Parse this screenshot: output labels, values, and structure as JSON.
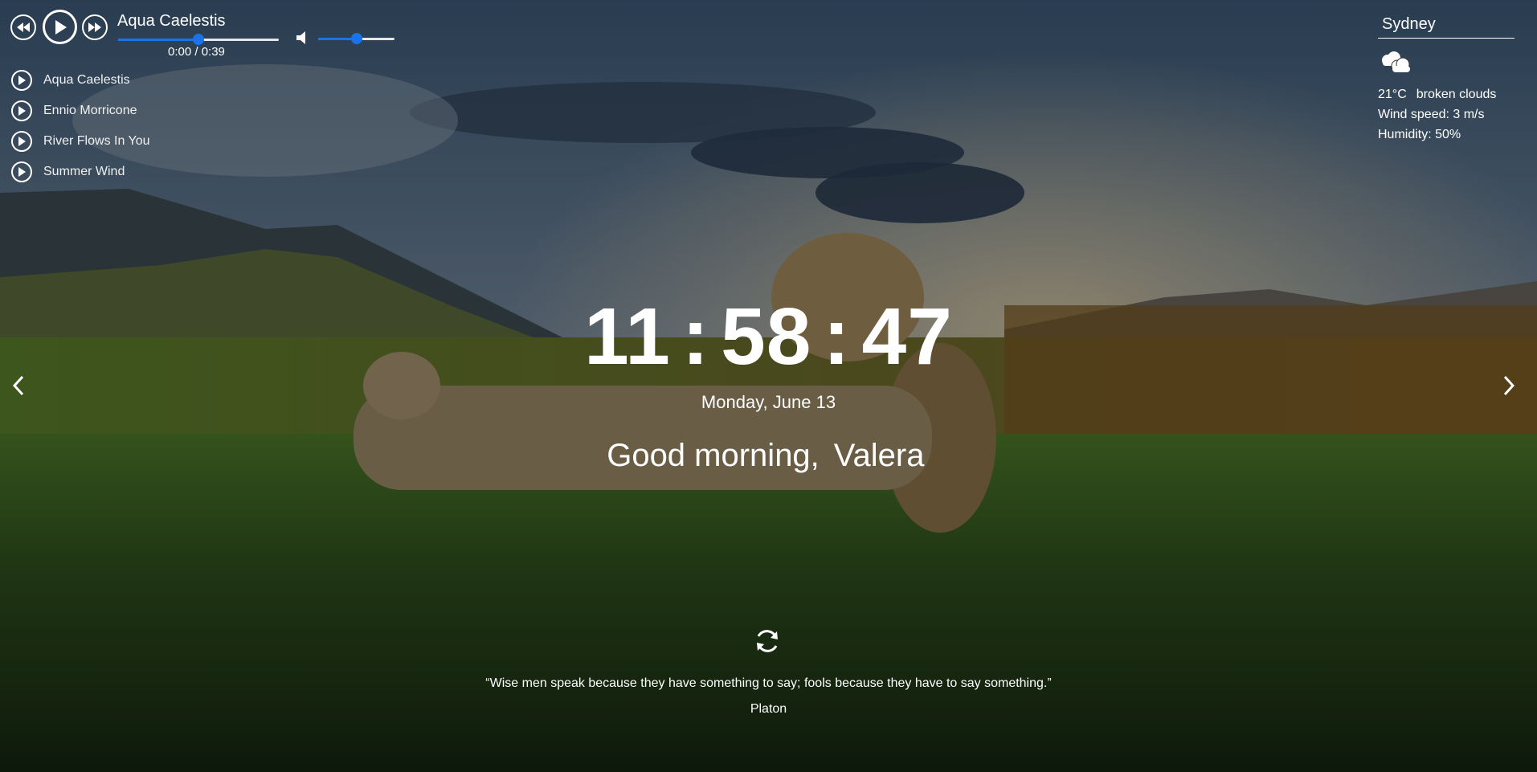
{
  "player": {
    "current_track": "Aqua Caelestis",
    "time": "0:00 / 0:39",
    "progress": 0.5,
    "volume": 0.5,
    "icons": {
      "prev": "rewind-icon",
      "play": "play-icon",
      "next": "fast-forward-icon",
      "volume": "speaker-icon"
    },
    "playlist": [
      {
        "label": "Aqua Caelestis"
      },
      {
        "label": "Ennio Morricone"
      },
      {
        "label": "River Flows In You"
      },
      {
        "label": "Summer Wind"
      }
    ]
  },
  "weather": {
    "city": "Sydney",
    "icon": "broken-clouds-icon",
    "temperature": "21°C",
    "description": "broken clouds",
    "wind": "Wind speed: 3 m/s",
    "humidity": "Humidity: 50%"
  },
  "clock": {
    "hours": "11",
    "minutes": "58",
    "seconds": "47",
    "separator": ":"
  },
  "date": "Monday, June 13",
  "greeting": {
    "text": "Good morning,",
    "name": "Valera"
  },
  "quote": {
    "text": "“Wise men speak because they have something to say; fools because they have to say something.”",
    "author": "Platon"
  },
  "colors": {
    "accent": "#1a73e8",
    "text": "#ffffff"
  }
}
